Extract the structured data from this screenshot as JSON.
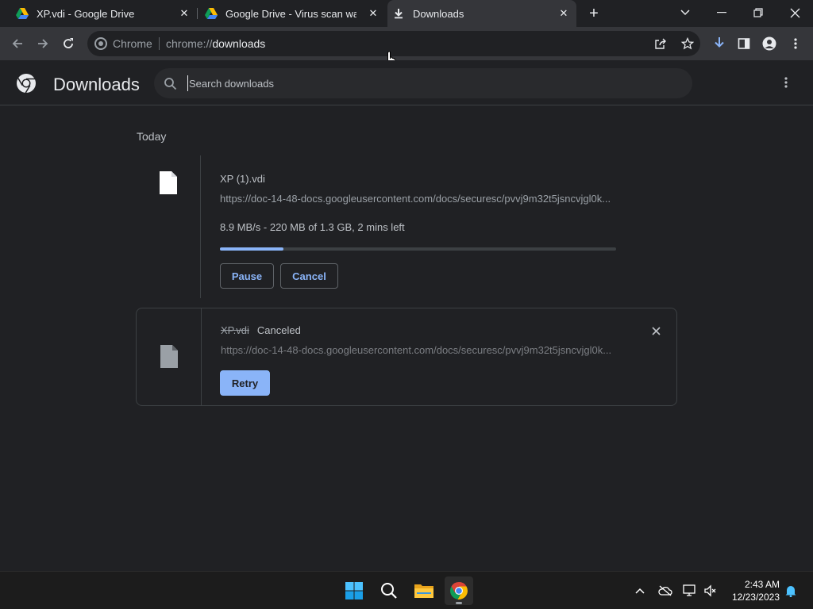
{
  "tabs": [
    {
      "title": "XP.vdi - Google Drive",
      "icon": "google-drive-icon",
      "active": false
    },
    {
      "title": "Google Drive - Virus scan warning",
      "icon": "google-drive-icon",
      "active": false
    },
    {
      "title": "Downloads",
      "icon": "download-icon",
      "active": true
    }
  ],
  "address_bar": {
    "chip": "Chrome",
    "url_scheme": "chrome://",
    "url_host": "downloads"
  },
  "page": {
    "title": "Downloads",
    "search_placeholder": "Search downloads"
  },
  "section": {
    "date": "Today"
  },
  "downloads": [
    {
      "filename": "XP (1).vdi",
      "url": "https://doc-14-48-docs.googleusercontent.com/docs/securesc/pvvj9m32t5jsncvjgl0k...",
      "status": "8.9 MB/s - 220 MB of 1.3 GB, 2 mins left",
      "progress": 0.16,
      "buttons": {
        "pause": "Pause",
        "cancel": "Cancel"
      }
    },
    {
      "filename": "XP.vdi",
      "state": "Canceled",
      "url": "https://doc-14-48-docs.googleusercontent.com/docs/securesc/pvvj9m32t5jsncvjgl0k...",
      "buttons": {
        "retry": "Retry"
      }
    }
  ],
  "taskbar": {
    "apps": [
      "start-icon",
      "search-icon",
      "file-explorer-icon",
      "chrome-icon"
    ],
    "time": "2:43 AM",
    "date": "12/23/2023"
  },
  "colors": {
    "background": "#202124",
    "toolbar": "#35363a",
    "accent": "#8ab4f8",
    "taskbar": "#1c1c1c"
  }
}
